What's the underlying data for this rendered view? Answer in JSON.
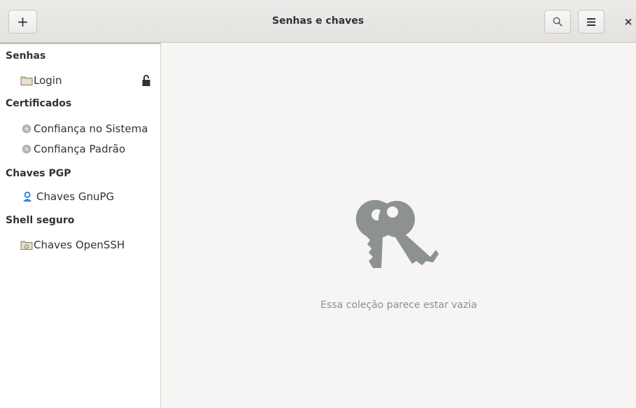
{
  "window": {
    "title": "Senhas e chaves"
  },
  "headerbar": {
    "add_label": "+",
    "close_label": "×",
    "icons": {
      "add": "plus-icon",
      "search": "search-icon",
      "menu": "hamburger-menu-icon",
      "close": "close-icon"
    }
  },
  "sidebar": {
    "sections": [
      {
        "heading": "Senhas",
        "items": [
          {
            "label": "Login",
            "icon": "folder-icon",
            "locked": true
          }
        ]
      },
      {
        "heading": "Certificados",
        "items": [
          {
            "label": "Confiança no Sistema",
            "icon": "gear-icon"
          },
          {
            "label": "Confiança Padrão",
            "icon": "gear-icon"
          }
        ]
      },
      {
        "heading": "Chaves PGP",
        "items": [
          {
            "label": "Chaves GnuPG",
            "icon": "user-icon"
          }
        ]
      },
      {
        "heading": "Shell seguro",
        "items": [
          {
            "label": "Chaves OpenSSH",
            "icon": "home-folder-icon"
          }
        ]
      }
    ]
  },
  "main": {
    "empty_icon": "keys-icon",
    "empty_message": "Essa coleção parece estar vazia"
  },
  "colors": {
    "headerbar_bg": "#e8e6e3",
    "sidebar_bg": "#ffffff",
    "main_bg": "#f6f5f4",
    "text": "#2e3436",
    "muted_text": "#8b8e8f",
    "keys_icon": "#8e9192",
    "gnupg_accent": "#3584e4"
  }
}
